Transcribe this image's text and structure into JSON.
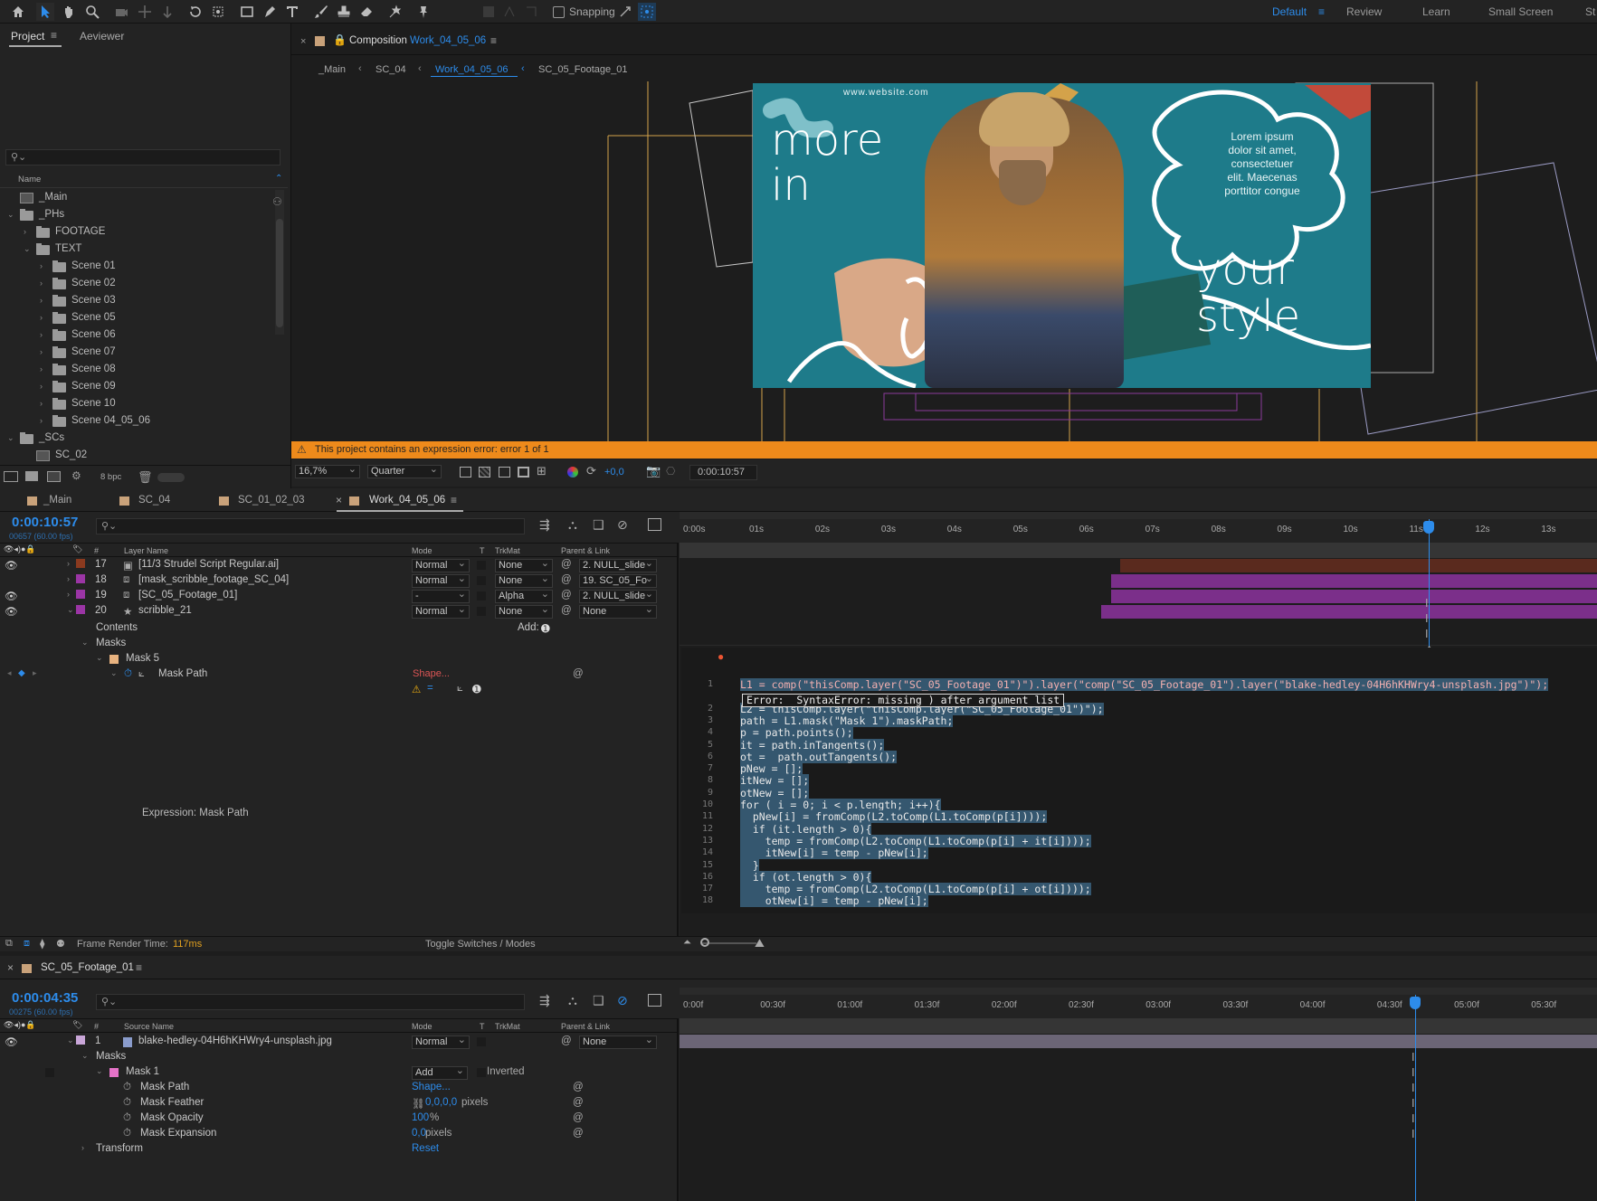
{
  "toolbar": {
    "snapping_label": "Snapping",
    "workspaces": [
      "Default",
      "Review",
      "Learn",
      "Small Screen",
      "St"
    ]
  },
  "project_panel": {
    "tabs": [
      "Project",
      "Aeviewer"
    ],
    "search_placeholder": "",
    "column_name": "Name",
    "items": [
      {
        "label": "_Main",
        "kind": "comp",
        "indent": 0,
        "arrow": ""
      },
      {
        "label": "_PHs",
        "kind": "folder",
        "indent": 0,
        "arrow": "⌄"
      },
      {
        "label": "FOOTAGE",
        "kind": "folder",
        "indent": 1,
        "arrow": "›"
      },
      {
        "label": "TEXT",
        "kind": "folder",
        "indent": 1,
        "arrow": "⌄"
      },
      {
        "label": "Scene 01",
        "kind": "folder",
        "indent": 2,
        "arrow": "›"
      },
      {
        "label": "Scene 02",
        "kind": "folder",
        "indent": 2,
        "arrow": "›"
      },
      {
        "label": "Scene 03",
        "kind": "folder",
        "indent": 2,
        "arrow": "›"
      },
      {
        "label": "Scene 05",
        "kind": "folder",
        "indent": 2,
        "arrow": "›"
      },
      {
        "label": "Scene 06",
        "kind": "folder",
        "indent": 2,
        "arrow": "›"
      },
      {
        "label": "Scene 07",
        "kind": "folder",
        "indent": 2,
        "arrow": "›"
      },
      {
        "label": "Scene 08",
        "kind": "folder",
        "indent": 2,
        "arrow": "›"
      },
      {
        "label": "Scene 09",
        "kind": "folder",
        "indent": 2,
        "arrow": "›"
      },
      {
        "label": "Scene 10",
        "kind": "folder",
        "indent": 2,
        "arrow": "›"
      },
      {
        "label": "Scene 04_05_06",
        "kind": "folder",
        "indent": 2,
        "arrow": "›"
      },
      {
        "label": "_SCs",
        "kind": "folder",
        "indent": 0,
        "arrow": "⌄"
      },
      {
        "label": "SC_02",
        "kind": "comp",
        "indent": 1,
        "arrow": ""
      }
    ],
    "bpc": "8 bpc"
  },
  "composition": {
    "header_prefix": "Composition",
    "name": "Work_04_05_06",
    "breadcrumbs": [
      "_Main",
      "SC_04",
      "Work_04_05_06",
      "SC_05_Footage_01"
    ],
    "artwork": {
      "site": "www.website.com",
      "text_left": "more in",
      "text_right": "your style",
      "lorem": [
        "Lorem ipsum",
        "dolor sit amet,",
        "consectetuer",
        "elit. Maecenas",
        "porttitor congue"
      ]
    },
    "error_message": "This project contains an expression error: error 1 of 1",
    "zoom": "16,7%",
    "resolution": "Quarter",
    "exposure": "+0,0",
    "timecode": "0:00:10:57"
  },
  "timeline1": {
    "tabs": [
      "_Main",
      "SC_04",
      "SC_01_02_03",
      "Work_04_05_06"
    ],
    "timecode": "0:00:10:57",
    "subcode": "00657 (60.00 fps)",
    "columns": {
      "num": "#",
      "name": "Layer Name",
      "mode": "Mode",
      "t": "T",
      "trkmat": "TrkMat",
      "parent": "Parent & Link"
    },
    "ruler": [
      "0:00s",
      "01s",
      "02s",
      "03s",
      "04s",
      "05s",
      "06s",
      "07s",
      "08s",
      "09s",
      "10s",
      "11s",
      "12s",
      "13s"
    ],
    "playhead_fraction": 0.817,
    "layers": [
      {
        "num": "17",
        "name": "[11/3 Strudel Script Regular.ai]",
        "mode": "Normal",
        "trkmat": "None",
        "parent": "2. NULL_slide",
        "color": "#8b3a1f",
        "icon": "ai-file-icon",
        "bar_color": "#5a2a1e",
        "bar_start": 0.48
      },
      {
        "num": "18",
        "name": "[mask_scribble_footage_SC_04]",
        "mode": "Normal",
        "trkmat": "None",
        "parent": "19. SC_05_Fo",
        "color": "#9b35a5",
        "icon": "precomp-icon",
        "bar_color": "#7b2f8a",
        "bar_start": 0.47
      },
      {
        "num": "19",
        "name": "[SC_05_Footage_01]",
        "mode": "-",
        "trkmat": "Alpha",
        "parent": "2. NULL_slide",
        "color": "#9b35a5",
        "icon": "precomp-icon",
        "bar_color": "#7b2f8a",
        "bar_start": 0.47
      },
      {
        "num": "20",
        "name": "scribble_21",
        "mode": "Normal",
        "trkmat": "None",
        "parent": "None",
        "color": "#9b35a5",
        "icon": "star-icon",
        "bar_color": "#7b2f8a",
        "bar_start": 0.46
      }
    ],
    "contents_label": "Contents",
    "add_label": "Add:",
    "masks_label": "Masks",
    "mask_name": "Mask 5",
    "mask_path_label": "Mask Path",
    "mask_path_value": "Shape...",
    "expression_label": "Expression: Mask Path",
    "code_lines": [
      "L1 = comp(\"thisComp.layer(\"SC_05_Footage_01\")\").layer(\"comp(\"SC_05_Footage_01\").layer(\"blake-hedley-04H6hKHWry4-unsplash.jpg\")\");",
      "L2 = thisComp.layer(\"thisComp.layer(\"SC_05_Footage_01\")\");",
      "path = L1.mask(\"Mask 1\").maskPath;",
      "p = path.points();",
      "it = path.inTangents();",
      "ot =  path.outTangents();",
      "pNew = [];",
      "itNew = [];",
      "otNew = [];",
      "for ( i = 0; i < p.length; i++){",
      "  pNew[i] = fromComp(L2.toComp(L1.toComp(p[i])));",
      "  if (it.length > 0){",
      "    temp = fromComp(L2.toComp(L1.toComp(p[i] + it[i])));",
      "    itNew[i] = temp - pNew[i];",
      "  }",
      "  if (ot.length > 0){",
      "    temp = fromComp(L2.toComp(L1.toComp(p[i] + ot[i])));",
      "    otNew[i] = temp - pNew[i];"
    ],
    "error_text": "Error:  SyntaxError: missing ) after argument list",
    "frame_render_label": "Frame Render Time:",
    "frame_render_value": "117ms",
    "toggle_label": "Toggle Switches / Modes"
  },
  "timeline2": {
    "tab": "SC_05_Footage_01",
    "timecode": "0:00:04:35",
    "subcode": "00275 (60.00 fps)",
    "columns": {
      "num": "#",
      "name": "Source Name",
      "mode": "Mode",
      "t": "T",
      "trkmat": "TrkMat",
      "parent": "Parent & Link"
    },
    "ruler": [
      "0:00f",
      "00:30f",
      "01:00f",
      "01:30f",
      "02:00f",
      "02:30f",
      "03:00f",
      "03:30f",
      "04:00f",
      "04:30f",
      "05:00f",
      "05:30f"
    ],
    "playhead_fraction": 0.802,
    "layer": {
      "num": "1",
      "name": "blake-hedley-04H6hKHWry4-unsplash.jpg",
      "mode": "Normal",
      "parent": "None",
      "color": "#c9a6d8"
    },
    "masks_label": "Masks",
    "mask": {
      "name": "Mask 1",
      "mode": "Add",
      "inverted": "Inverted"
    },
    "properties": [
      {
        "label": "Mask Path",
        "value": "Shape...",
        "unit": ""
      },
      {
        "label": "Mask Feather",
        "value": "0,0,0,0",
        "unit": "pixels"
      },
      {
        "label": "Mask Opacity",
        "value": "100",
        "unit": "%"
      },
      {
        "label": "Mask Expansion",
        "value": "0,0",
        "unit": "pixels"
      }
    ],
    "transform_label": "Transform",
    "transform_value": "Reset"
  },
  "colors": {
    "accent": "#2d8ceb",
    "error_bar": "#ee8a1b",
    "layer_purple": "#7b2f8a",
    "code_highlight": "#35576f"
  }
}
